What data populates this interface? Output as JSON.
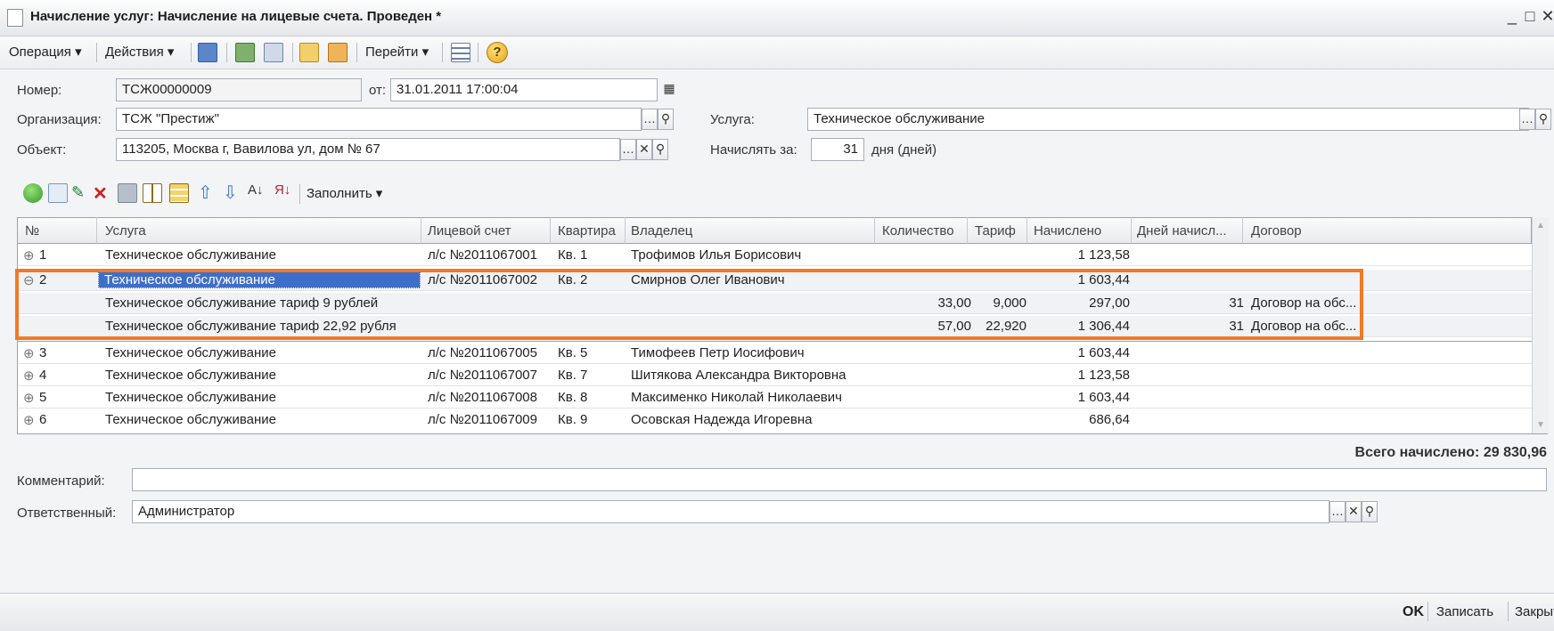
{
  "window": {
    "title": "Начисление услуг: Начисление на лицевые счета. Проведен *"
  },
  "toolbar": {
    "operation": "Операция ▾",
    "actions": "Действия ▾",
    "goto": "Перейти ▾"
  },
  "header": {
    "number_label": "Номер:",
    "number_value": "ТСЖ00000009",
    "date_label": "от:",
    "date_value": "31.01.2011 17:00:04",
    "org_label": "Организация:",
    "org_value": "ТСЖ \"Престиж\"",
    "service_label": "Услуга:",
    "service_value": "Техническое обслуживание",
    "object_label": "Объект:",
    "object_value": "113205, Москва г, Вавилова ул, дом № 67",
    "charge_for_label": "Начислять за:",
    "charge_for_value": "31",
    "charge_for_unit": "дня (дней)"
  },
  "table_toolbar": {
    "fill_label": "Заполнить ▾"
  },
  "table": {
    "columns": [
      "№",
      "Услуга",
      "Лицевой счет",
      "Квартира",
      "Владелец",
      "Количество",
      "Тариф",
      "Начислено",
      "Дней начисл...",
      "Договор"
    ],
    "rows": [
      {
        "expand": "⊕",
        "n": "1",
        "service": "Техническое обслуживание",
        "account": "л/с №2011067001",
        "flat": "Кв. 1",
        "owner": "Трофимов Илья Борисович",
        "qty": "",
        "tariff": "",
        "charged": "1 123,58",
        "days": "",
        "contract": ""
      },
      {
        "expand": "⊖",
        "n": "2",
        "service": "Техническое обслуживание",
        "account": "л/с №2011067002",
        "flat": "Кв. 2",
        "owner": "Смирнов Олег Иванович",
        "qty": "",
        "tariff": "",
        "charged": "1 603,44",
        "days": "",
        "contract": ""
      },
      {
        "expand": "",
        "n": "",
        "service": "Техническое обслуживание тариф 9 рублей",
        "account": "",
        "flat": "",
        "owner": "",
        "qty": "33,00",
        "tariff": "9,000",
        "charged": "297,00",
        "days": "31",
        "contract": "Договор на обс..."
      },
      {
        "expand": "",
        "n": "",
        "service": "Техническое обслуживание тариф 22,92 рубля",
        "account": "",
        "flat": "",
        "owner": "",
        "qty": "57,00",
        "tariff": "22,920",
        "charged": "1 306,44",
        "days": "31",
        "contract": "Договор на обс..."
      },
      {
        "expand": "⊕",
        "n": "3",
        "service": "Техническое обслуживание",
        "account": "л/с №2011067005",
        "flat": "Кв. 5",
        "owner": "Тимофеев Петр Иосифович",
        "qty": "",
        "tariff": "",
        "charged": "1 603,44",
        "days": "",
        "contract": ""
      },
      {
        "expand": "⊕",
        "n": "4",
        "service": "Техническое обслуживание",
        "account": "л/с №2011067007",
        "flat": "Кв. 7",
        "owner": "Шитякова Александра Викторовна",
        "qty": "",
        "tariff": "",
        "charged": "1 123,58",
        "days": "",
        "contract": ""
      },
      {
        "expand": "⊕",
        "n": "5",
        "service": "Техническое обслуживание",
        "account": "л/с №2011067008",
        "flat": "Кв. 8",
        "owner": "Максименко Николай Николаевич",
        "qty": "",
        "tariff": "",
        "charged": "1 603,44",
        "days": "",
        "contract": ""
      },
      {
        "expand": "⊕",
        "n": "6",
        "service": "Техническое обслуживание",
        "account": "л/с №2011067009",
        "flat": "Кв. 9",
        "owner": "Осовская Надежда Игоревна",
        "qty": "",
        "tariff": "",
        "charged": "686,64",
        "days": "",
        "contract": ""
      }
    ]
  },
  "total": {
    "label": "Всего начислено: 29 830,96"
  },
  "footer": {
    "comment_label": "Комментарий:",
    "comment_value": "",
    "responsible_label": "Ответственный:",
    "responsible_value": "Администратор"
  },
  "buttons": {
    "ok": "OK",
    "save": "Записать",
    "close": "Закрыть"
  },
  "colors": {
    "highlight": "#f07a26",
    "selection": "#3f6ec8"
  }
}
